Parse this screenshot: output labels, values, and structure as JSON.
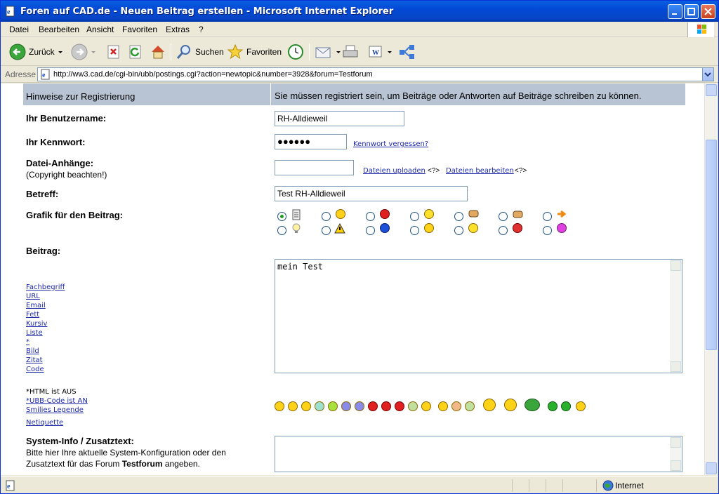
{
  "window": {
    "title": "Foren auf CAD.de - Neuen Beitrag erstellen - Microsoft Internet Explorer"
  },
  "menu": [
    "Datei",
    "Bearbeiten",
    "Ansicht",
    "Favoriten",
    "Extras",
    "?"
  ],
  "toolbar": {
    "back": "Zurück",
    "search": "Suchen",
    "favorites": "Favoriten"
  },
  "address": {
    "label": "Adresse",
    "url": "http://ww3.cad.de/cgi-bin/ubb/postings.cgi?action=newtopic&number=3928&forum=Testforum"
  },
  "form": {
    "hint_label": "Hinweise zur Registrierung",
    "hint_text": "Sie müssen registriert sein, um Beiträge oder Antworten auf Beiträge schreiben zu können.",
    "username_label": "Ihr Benutzername:",
    "username_value": "RH-Alldieweil",
    "password_label": "Ihr Kennwort:",
    "password_value": "●●●●●●",
    "forgot_link": "Kennwort vergessen?",
    "attach_label": "Datei-Anhänge:",
    "attach_note": "(Copyright beachten!)",
    "upload_link": "Dateien uploaden",
    "help1": "<?>",
    "edit_link": "Dateien bearbeiten",
    "help2": "<?>",
    "subject_label": "Betreff:",
    "subject_value": "Test RH-Alldieweil",
    "icon_label": "Grafik für den Beitrag:",
    "post_label": "Beitrag:",
    "post_value": "mein Test",
    "ubb_links": [
      "Fachbegriff",
      "URL",
      "Email",
      "Fett",
      "Kursiv",
      "Liste",
      "*",
      "Bild",
      "Zitat",
      "Code"
    ],
    "html_status": "*HTML ist AUS",
    "ubb_status": "*UBB-Code ist AN",
    "smilies_link": "Smilies Legende",
    "netiquette_link": "Netiquette",
    "sysinfo_label": "System-Info / Zusatztext:",
    "sysinfo_text1": "Bitte hier Ihre aktuelle System-Konfiguration oder den",
    "sysinfo_text2_pre": "Zusatztext für das Forum ",
    "sysinfo_forum": "Testforum",
    "sysinfo_text2_post": " angeben."
  },
  "status": {
    "zone": "Internet"
  },
  "colors": {
    "hint_bg": "#b8c4d4",
    "row_bg": "#dcdcdc",
    "link": "#1f2aa8",
    "title_blue": "#0349d6"
  }
}
